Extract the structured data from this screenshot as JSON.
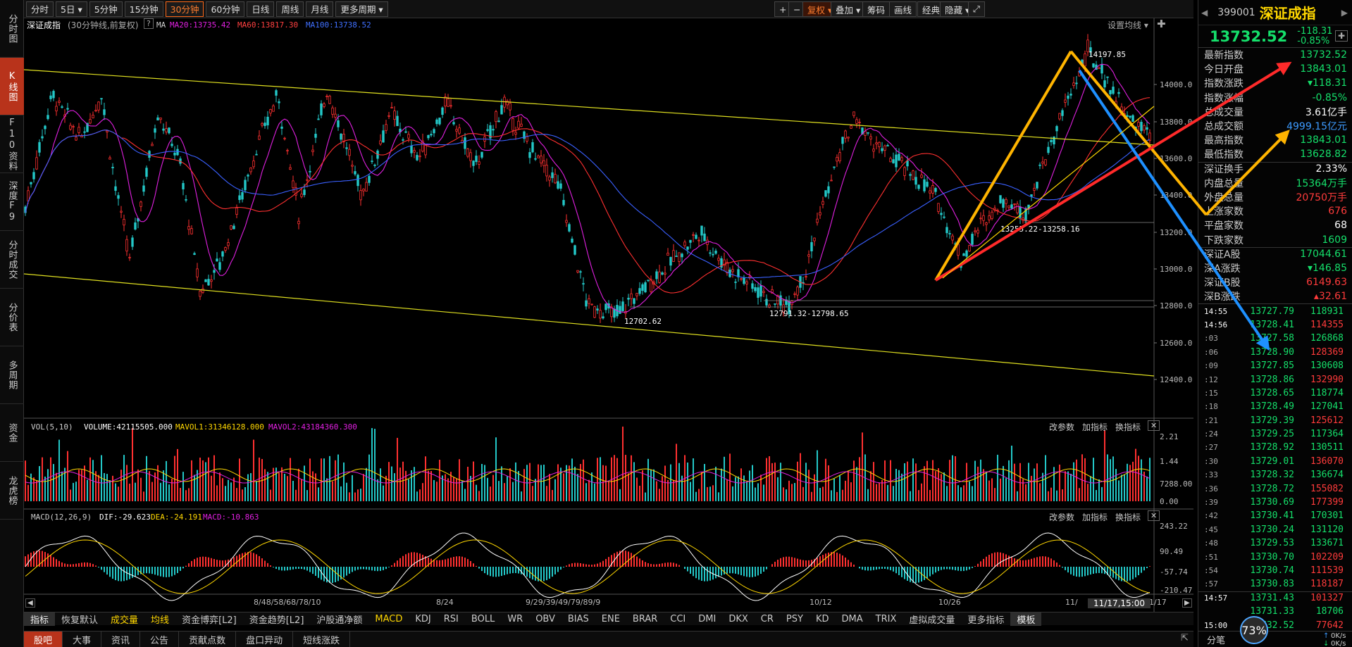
{
  "left_tabs": [
    "分时图",
    "K线图",
    "F10资料",
    "深度F9",
    "分时成交",
    "分价表",
    "多周期",
    "资金",
    "龙虎榜"
  ],
  "toolbar": {
    "items": [
      "分时",
      "5日 ▾",
      "5分钟",
      "15分钟",
      "30分钟",
      "60分钟",
      "日线",
      "周线",
      "月线",
      "更多周期 ▾"
    ],
    "active_index": 4,
    "right_items": [
      "复权 ▾",
      "叠加 ▾",
      "筹码",
      "画线",
      "经典",
      "隐藏 ▾"
    ]
  },
  "header": {
    "name": "深证成指",
    "params": "(30分钟线,前复权)",
    "ma_label": "MA",
    "ma20": "MA20:13735.42",
    "ma60": "MA60:13817.30",
    "ma100": "MA100:13738.52",
    "settings": "设置均线 ▾"
  },
  "annotations": {
    "high": "14197.85",
    "low1": "12702.62",
    "low2": "12791.32-12798.65",
    "mid": "13255.22-13258.16"
  },
  "y_axis": [
    "14000.0",
    "13800.0",
    "13600.0",
    "13400.0",
    "13200.0",
    "13000.0",
    "12800.0",
    "12600.0",
    "12400.0"
  ],
  "vol": {
    "name": "VOL(5,10)",
    "volume": "VOLUME:42115505.000",
    "mavol1": "MAVOL1:31346128.000",
    "mavol2": "MAVOL2:43184360.300",
    "links": [
      "改参数",
      "加指标",
      "换指标"
    ],
    "axis": [
      "2.21",
      "1.44",
      "7288.00",
      "0.00"
    ]
  },
  "macd": {
    "name": "MACD(12,26,9)",
    "dif": "DIF:-29.623",
    "dea": "DEA:-24.191",
    "macd": "MACD:-10.863",
    "links": [
      "改参数",
      "加指标",
      "换指标"
    ],
    "axis": [
      "243.22",
      "90.49",
      "-57.74",
      "-210.47"
    ]
  },
  "x_axis": [
    "8/4",
    "8/5",
    "8/6",
    "8/7",
    "8/10",
    "8/24",
    "9/29",
    "9/30",
    "10/12",
    "10/26",
    "11/",
    "11/17"
  ],
  "x_dates": [
    "8/48/58/68/78/10",
    "8/24",
    "9/29/39/49/79/89/9",
    "10/12",
    "10/26",
    "11/",
    "11/17"
  ],
  "x_cursor": "11/17,15:00",
  "indicators": [
    "指标",
    "恢复默认",
    "成交量",
    "均线",
    "资金博弈[L2]",
    "资金趋势[L2]",
    "沪股通净额",
    "MACD",
    "KDJ",
    "RSI",
    "BOLL",
    "WR",
    "OBV",
    "BIAS",
    "ENE",
    "BRAR",
    "CCI",
    "DMI",
    "DKX",
    "CR",
    "PSY",
    "KD",
    "DMA",
    "TRIX",
    "虚拟成交量",
    "更多指标",
    "模板"
  ],
  "bottom_tabs": [
    "股吧",
    "大事",
    "资讯",
    "公告",
    "贡献点数",
    "盘口异动",
    "短线涨跌"
  ],
  "quote": {
    "code": "399001",
    "name": "深证成指",
    "price": "13732.52",
    "change": "-118.31",
    "pct": "-0.85%",
    "rows": [
      {
        "k": "最新指数",
        "v": "13732.52",
        "c": "#15e06b"
      },
      {
        "k": "今日开盘",
        "v": "13843.01",
        "c": "#15e06b"
      },
      {
        "k": "指数涨跌",
        "v": "▾118.31",
        "c": "#15e06b"
      },
      {
        "k": "指数涨幅",
        "v": "-0.85%",
        "c": "#15e06b"
      },
      {
        "k": "总成交量",
        "v": "3.61亿手",
        "c": "#ffffff"
      },
      {
        "k": "总成交额",
        "v": "4999.15亿元",
        "c": "#3d9bff"
      },
      {
        "k": "最高指数",
        "v": "13843.01",
        "c": "#15e06b"
      },
      {
        "k": "最低指数",
        "v": "13628.82",
        "c": "#15e06b"
      },
      {
        "k": "深证换手",
        "v": "2.33%",
        "c": "#ffffff"
      },
      {
        "k": "内盘总量",
        "v": "15364万手",
        "c": "#15e06b"
      },
      {
        "k": "外盘总量",
        "v": "20750万手",
        "c": "#ff3b3b"
      },
      {
        "k": "上涨家数",
        "v": "676",
        "c": "#ff3b3b"
      },
      {
        "k": "平盘家数",
        "v": "68",
        "c": "#ffffff"
      },
      {
        "k": "下跌家数",
        "v": "1609",
        "c": "#15e06b"
      },
      {
        "k": "深证A股",
        "v": "17044.61",
        "c": "#15e06b"
      },
      {
        "k": "深A涨跌",
        "v": "▾146.85",
        "c": "#15e06b"
      },
      {
        "k": "深证B股",
        "v": "6149.63",
        "c": "#ff3b3b"
      },
      {
        "k": "深B涨跌",
        "v": "▴32.61",
        "c": "#ff3b3b"
      }
    ]
  },
  "ticks": [
    {
      "t": "14:55",
      "p": "13727.79",
      "v": "118931",
      "c": "#15e06b"
    },
    {
      "t": "14:56",
      "p": "13728.41",
      "v": "114355",
      "c": "#ff3b3b"
    },
    {
      "t": ":03",
      "p": "13727.58",
      "v": "126868",
      "c": "#15e06b"
    },
    {
      "t": ":06",
      "p": "13728.90",
      "v": "128369",
      "c": "#ff3b3b"
    },
    {
      "t": ":09",
      "p": "13727.85",
      "v": "130608",
      "c": "#15e06b"
    },
    {
      "t": ":12",
      "p": "13728.86",
      "v": "132990",
      "c": "#ff3b3b"
    },
    {
      "t": ":15",
      "p": "13728.65",
      "v": "118774",
      "c": "#15e06b"
    },
    {
      "t": ":18",
      "p": "13728.49",
      "v": "127041",
      "c": "#15e06b"
    },
    {
      "t": ":21",
      "p": "13729.39",
      "v": "125612",
      "c": "#ff3b3b"
    },
    {
      "t": ":24",
      "p": "13729.25",
      "v": "117364",
      "c": "#15e06b"
    },
    {
      "t": ":27",
      "p": "13728.92",
      "v": "130511",
      "c": "#15e06b"
    },
    {
      "t": ":30",
      "p": "13729.01",
      "v": "136070",
      "c": "#ff3b3b"
    },
    {
      "t": ":33",
      "p": "13728.32",
      "v": "136674",
      "c": "#15e06b"
    },
    {
      "t": ":36",
      "p": "13728.72",
      "v": "155082",
      "c": "#ff3b3b"
    },
    {
      "t": ":39",
      "p": "13730.69",
      "v": "177399",
      "c": "#ff3b3b"
    },
    {
      "t": ":42",
      "p": "13730.41",
      "v": "170301",
      "c": "#15e06b"
    },
    {
      "t": ":45",
      "p": "13730.24",
      "v": "131120",
      "c": "#15e06b"
    },
    {
      "t": ":48",
      "p": "13729.53",
      "v": "133671",
      "c": "#15e06b"
    },
    {
      "t": ":51",
      "p": "13730.70",
      "v": "102209",
      "c": "#ff3b3b"
    },
    {
      "t": ":54",
      "p": "13730.74",
      "v": "111539",
      "c": "#ff3b3b"
    },
    {
      "t": ":57",
      "p": "13730.83",
      "v": "118187",
      "c": "#ff3b3b"
    },
    {
      "t": "14:57",
      "p": "13731.43",
      "v": "101327",
      "c": "#ff3b3b"
    },
    {
      "t": "",
      "p": "13731.33",
      "v": "18706",
      "c": "#15e06b"
    },
    {
      "t": "15:00",
      "p": "13732.52",
      "v": "77642",
      "c": "#ff3b3b"
    }
  ],
  "footer": {
    "fenbi": "分笔",
    "pct": "73%",
    "speed_up": "0K/s",
    "speed_down": "0K/s"
  }
}
